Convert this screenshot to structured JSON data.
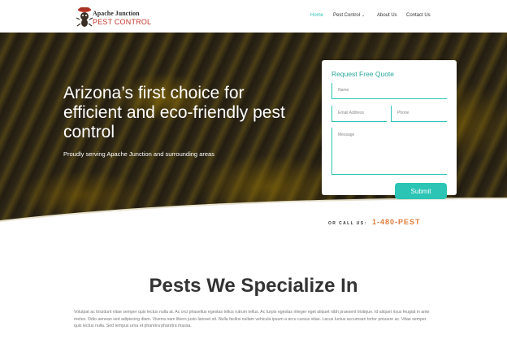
{
  "brand": {
    "line1": "Apache Junction",
    "line2": "PEST CONTROL",
    "icon": "bug-mascot-icon"
  },
  "nav": {
    "items": [
      {
        "label": "Home",
        "active": true
      },
      {
        "label": "Pest Control",
        "has_dropdown": true
      },
      {
        "label": "About Us"
      },
      {
        "label": "Contact Us"
      }
    ],
    "dropdown_icon": "chevron-down-icon"
  },
  "hero": {
    "title": "Arizona’s first choice for efficient and eco-friendly pest control",
    "subtitle": "Proudly serving Apache Junction and surrounding areas"
  },
  "quote_form": {
    "title": "Request Free Quote",
    "name_placeholder": "Name",
    "email_placeholder": "Email Address",
    "phone_placeholder": "Phone",
    "message_placeholder": "Message",
    "submit_label": "Submit"
  },
  "call": {
    "prefix": "OR CALL US:",
    "number": "1-480-PEST"
  },
  "section": {
    "title": "Pests We Specialize In",
    "body": "Volutpat ac tincidunt vitae semper quis lectus nulla at. Ac orci phasellus egestas tellus rutrum tellus. Ac turpis egestas integer eget aliquet nibh praesent tristique. Id aliquet risus feugiat in ante metus. Odio aenean sed adipiscing diam. Viverra nam libero justo laoreet sit. Nulla facilisi nullam vehicula ipsum a arcu cursus vitae. Lacus luctus accumsan tortor posuere ac. Vitae semper quis lectus nulla. Sed tempus urna et pharetra pharetra massa."
  },
  "colors": {
    "accent": "#2cc4b5",
    "brand_red": "#c0392b",
    "phone": "#e07b3a"
  }
}
